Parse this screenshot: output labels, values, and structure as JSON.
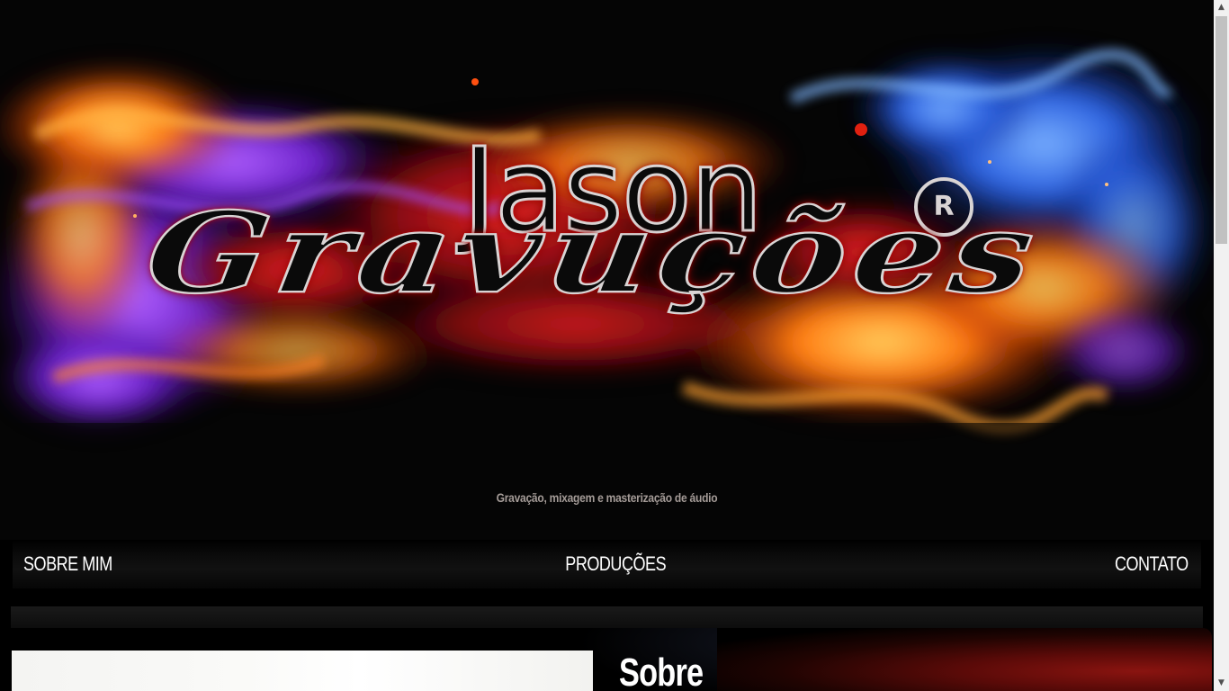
{
  "header": {
    "logo": {
      "line1": "Jason",
      "line2": "Gravuções",
      "registered_mark": "R"
    },
    "tagline": "Gravação, mixagem e masterização de áudio"
  },
  "nav": {
    "items": [
      {
        "label": "SOBRE MIM"
      },
      {
        "label": "PRODUÇÕES"
      },
      {
        "label": "CONTATO"
      }
    ]
  },
  "main": {
    "section_title": "Sobre"
  },
  "scrollbar": {
    "up_icon": "chevron-up-icon",
    "down_icon": "chevron-down-icon"
  },
  "colors": {
    "background": "#000000",
    "tagline": "#a59c98",
    "nav_text": "#ffffff",
    "flame_orange": "#ff6a00",
    "flame_purple": "#7a2ad6",
    "flame_blue": "#2f6fe0"
  }
}
